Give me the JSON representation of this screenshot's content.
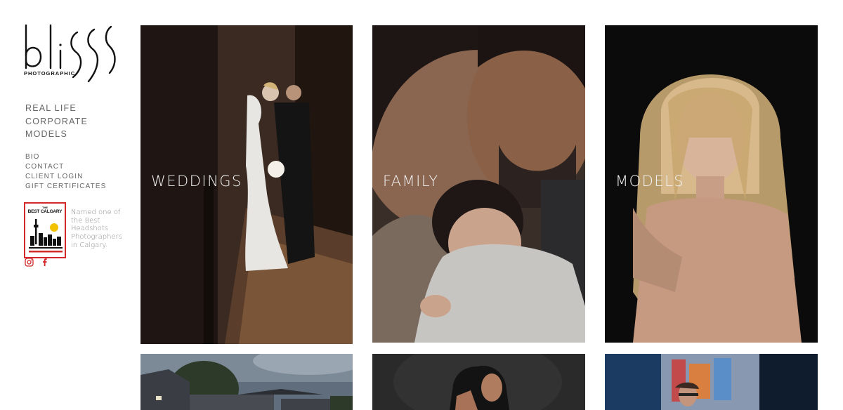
{
  "brand": {
    "logo_word": "bliss",
    "logo_sub": "PHOTOGRAPHIC"
  },
  "nav": {
    "main": [
      "REAL LIFE",
      "CORPORATE",
      "MODELS"
    ],
    "secondary": [
      "BIO",
      "CONTACT",
      "CLIENT LOGIN",
      "GIFT CERTIFICATES"
    ]
  },
  "award": {
    "badge_small": "THE",
    "badge_title": "BEST CALGARY",
    "text": "Named one of the Best Headshots Photographers in Calgary."
  },
  "social": {
    "icons": [
      "instagram-icon",
      "facebook-icon"
    ],
    "color": "#d22a2a"
  },
  "gallery": {
    "tiles": [
      {
        "caption": "WEDDINGS"
      },
      {
        "caption": "FAMILY"
      },
      {
        "caption": "MODELS"
      },
      {
        "caption": ""
      },
      {
        "caption": ""
      },
      {
        "caption": ""
      }
    ]
  }
}
